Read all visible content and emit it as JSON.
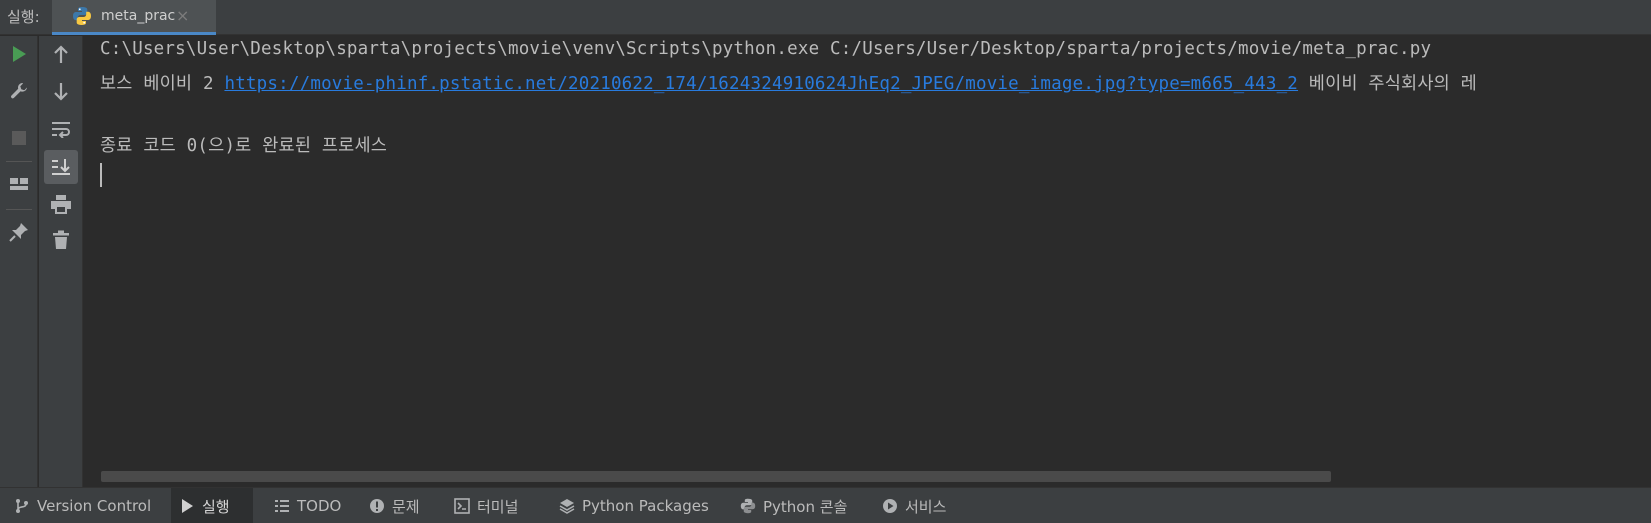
{
  "header": {
    "run_label": "실행:",
    "tab_name": "meta_prac",
    "tab_close_glyph": "×"
  },
  "console": {
    "lines": [
      "C:\\Users\\User\\Desktop\\sparta\\projects\\movie\\venv\\Scripts\\python.exe C:/Users/User/Desktop/sparta/projects/movie/meta_prac.py",
      "",
      "",
      "종료 코드 0(으)로 완료된 프로세스"
    ],
    "output_prefix": "보스 베이비 2 ",
    "output_link": "https://movie-phinf.pstatic.net/20210622_174/1624324910624JhEq2_JPEG/movie_image.jpg?type=m665_443_2",
    "output_suffix": " 베이비 주식회사의 레"
  },
  "bottom_bar": {
    "items": [
      {
        "label": "Version Control",
        "icon": "branch-icon"
      },
      {
        "label": "실행",
        "icon": "play-icon"
      },
      {
        "label": "TODO",
        "icon": "list-icon"
      },
      {
        "label": "문제",
        "icon": "warning-icon"
      },
      {
        "label": "터미널",
        "icon": "terminal-icon"
      },
      {
        "label": "Python Packages",
        "icon": "layers-icon"
      },
      {
        "label": "Python 콘솔",
        "icon": "python-icon"
      },
      {
        "label": "서비스",
        "icon": "services-icon"
      }
    ]
  },
  "colors": {
    "accent": "#4a88c7",
    "link": "#287bde",
    "run_green": "#499c54"
  }
}
